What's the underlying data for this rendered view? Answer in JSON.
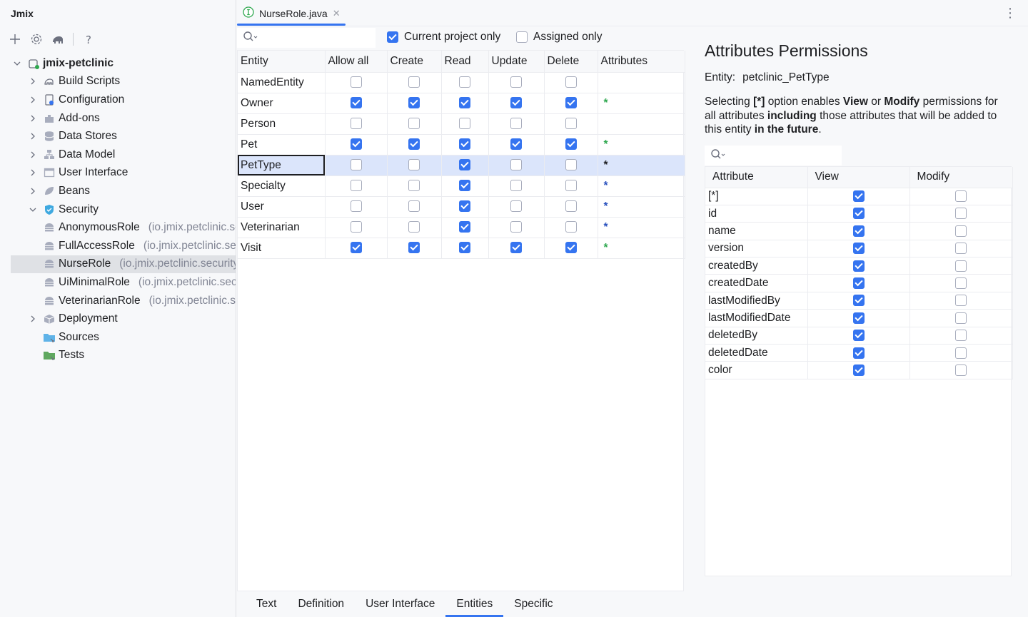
{
  "sidebar": {
    "title": "Jmix",
    "toolbar": [
      {
        "icon": "plus-icon"
      },
      {
        "icon": "gear-icon"
      },
      {
        "icon": "gradle-elephant-icon"
      },
      {
        "icon": "help-icon"
      }
    ],
    "tree": [
      {
        "label": "jmix-petclinic",
        "depth": 0,
        "chevron": "down",
        "icon": "project-icon",
        "bold": true,
        "pkg": ""
      },
      {
        "label": "Build Scripts",
        "depth": 1,
        "chevron": "right",
        "icon": "build-scripts-icon",
        "bold": false,
        "pkg": ""
      },
      {
        "label": "Configuration",
        "depth": 1,
        "chevron": "right",
        "icon": "configuration-icon",
        "bold": false,
        "pkg": ""
      },
      {
        "label": "Add-ons",
        "depth": 1,
        "chevron": "right",
        "icon": "addons-icon",
        "bold": false,
        "pkg": ""
      },
      {
        "label": "Data Stores",
        "depth": 1,
        "chevron": "right",
        "icon": "database-icon",
        "bold": false,
        "pkg": ""
      },
      {
        "label": "Data Model",
        "depth": 1,
        "chevron": "right",
        "icon": "data-model-icon",
        "bold": false,
        "pkg": ""
      },
      {
        "label": "User Interface",
        "depth": 1,
        "chevron": "right",
        "icon": "window-icon",
        "bold": false,
        "pkg": ""
      },
      {
        "label": "Beans",
        "depth": 1,
        "chevron": "right",
        "icon": "beans-leaf-icon",
        "bold": false,
        "pkg": ""
      },
      {
        "label": "Security",
        "depth": 1,
        "chevron": "down",
        "icon": "shield-icon",
        "bold": false,
        "pkg": ""
      },
      {
        "label": "AnonymousRole",
        "depth": 2,
        "chevron": "",
        "icon": "role-icon",
        "bold": false,
        "pkg": "(io.jmix.petclinic.security)"
      },
      {
        "label": "FullAccessRole",
        "depth": 2,
        "chevron": "",
        "icon": "role-icon",
        "bold": false,
        "pkg": "(io.jmix.petclinic.security)"
      },
      {
        "label": "NurseRole",
        "depth": 2,
        "chevron": "",
        "icon": "role-icon",
        "bold": false,
        "pkg": "(io.jmix.petclinic.security)",
        "selected": true
      },
      {
        "label": "UiMinimalRole",
        "depth": 2,
        "chevron": "",
        "icon": "role-icon",
        "bold": false,
        "pkg": "(io.jmix.petclinic.security)"
      },
      {
        "label": "VeterinarianRole",
        "depth": 2,
        "chevron": "",
        "icon": "role-icon",
        "bold": false,
        "pkg": "(io.jmix.petclinic.security)"
      },
      {
        "label": "Deployment",
        "depth": 1,
        "chevron": "right",
        "icon": "deployment-box-icon",
        "bold": false,
        "pkg": ""
      },
      {
        "label": "Sources",
        "depth": 1,
        "chevron": "",
        "icon": "sources-folder-icon",
        "bold": false,
        "pkg": ""
      },
      {
        "label": "Tests",
        "depth": 1,
        "chevron": "",
        "icon": "tests-folder-icon",
        "bold": false,
        "pkg": ""
      }
    ]
  },
  "editor": {
    "tab_name": "NurseRole.java",
    "tab_icon": "interface-icon",
    "more_icon": "more-vertical-icon"
  },
  "filters": {
    "search_placeholder": "",
    "current_project_label": "Current project only",
    "current_project_checked": true,
    "assigned_label": "Assigned only",
    "assigned_checked": false
  },
  "entity_table": {
    "headers": [
      "Entity",
      "Allow all",
      "Create",
      "Read",
      "Update",
      "Delete",
      "Attributes"
    ],
    "rows": [
      {
        "name": "NamedEntity",
        "allow": false,
        "create": false,
        "read": false,
        "update": false,
        "delete": false,
        "attr": ""
      },
      {
        "name": "Owner",
        "allow": true,
        "create": true,
        "read": true,
        "update": true,
        "delete": true,
        "attr": "*",
        "attr_color": "#2fa84f"
      },
      {
        "name": "Person",
        "allow": false,
        "create": false,
        "read": false,
        "update": false,
        "delete": false,
        "attr": ""
      },
      {
        "name": "Pet",
        "allow": true,
        "create": true,
        "read": true,
        "update": true,
        "delete": true,
        "attr": "*",
        "attr_color": "#2fa84f"
      },
      {
        "name": "PetType",
        "allow": false,
        "create": false,
        "read": true,
        "update": false,
        "delete": false,
        "attr": "*",
        "attr_color": "#1e1f22",
        "selected": true
      },
      {
        "name": "Specialty",
        "allow": false,
        "create": false,
        "read": true,
        "update": false,
        "delete": false,
        "attr": "*",
        "attr_color": "#2a52be"
      },
      {
        "name": "User",
        "allow": false,
        "create": false,
        "read": true,
        "update": false,
        "delete": false,
        "attr": "*",
        "attr_color": "#2a52be"
      },
      {
        "name": "Veterinarian",
        "allow": false,
        "create": false,
        "read": true,
        "update": false,
        "delete": false,
        "attr": "*",
        "attr_color": "#2a52be"
      },
      {
        "name": "Visit",
        "allow": true,
        "create": true,
        "read": true,
        "update": true,
        "delete": true,
        "attr": "*",
        "attr_color": "#2fa84f"
      }
    ]
  },
  "attr_panel": {
    "title": "Attributes Permissions",
    "entity_label": "Entity:",
    "entity_value": "petclinic_PetType",
    "desc_parts": [
      "Selecting ",
      "[*]",
      " option enables ",
      "View",
      " or ",
      "Modify",
      " permissions for all attributes ",
      "including",
      " those attributes that will be added to this entity ",
      "in the future",
      "."
    ],
    "search_placeholder": "",
    "headers": [
      "Attribute",
      "View",
      "Modify"
    ],
    "rows": [
      {
        "name": "[*]",
        "view": true,
        "modify": false
      },
      {
        "name": "id",
        "view": true,
        "modify": false
      },
      {
        "name": "name",
        "view": true,
        "modify": false
      },
      {
        "name": "version",
        "view": true,
        "modify": false
      },
      {
        "name": "createdBy",
        "view": true,
        "modify": false
      },
      {
        "name": "createdDate",
        "view": true,
        "modify": false
      },
      {
        "name": "lastModifiedBy",
        "view": true,
        "modify": false
      },
      {
        "name": "lastModifiedDate",
        "view": true,
        "modify": false
      },
      {
        "name": "deletedBy",
        "view": true,
        "modify": false
      },
      {
        "name": "deletedDate",
        "view": true,
        "modify": false
      },
      {
        "name": "color",
        "view": true,
        "modify": false
      }
    ]
  },
  "bottom_tabs": [
    {
      "label": "Text",
      "active": false
    },
    {
      "label": "Definition",
      "active": false
    },
    {
      "label": "User Interface",
      "active": false
    },
    {
      "label": "Entities",
      "active": true
    },
    {
      "label": "Specific",
      "active": false
    }
  ],
  "colors": {
    "accent": "#3574f0",
    "selection": "#dbe5fb",
    "sidebar_selection": "#dfe1e5"
  }
}
